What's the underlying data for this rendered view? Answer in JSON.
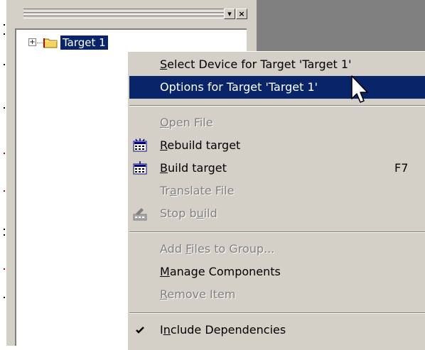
{
  "panel": {
    "title_buttons": {
      "dropdown_label": "▾",
      "close_label": "×"
    }
  },
  "tree": {
    "root": {
      "label": "Target 1",
      "expander": "+"
    }
  },
  "context_menu": {
    "items": [
      {
        "label": "Select Device for Target 'Target 1'",
        "accel": "S",
        "enabled": true
      },
      {
        "label": "Options for Target 'Target 1'",
        "enabled": true,
        "highlighted": true
      },
      {
        "label": "Open File",
        "accel": "O",
        "enabled": false
      },
      {
        "label": "Rebuild target",
        "accel": "R",
        "enabled": true,
        "icon": "rebuild-icon"
      },
      {
        "label": "Build target",
        "accel": "B",
        "enabled": true,
        "icon": "build-icon",
        "shortcut": "F7"
      },
      {
        "label": "Translate File",
        "accel": "a",
        "enabled": false
      },
      {
        "label": "Stop build",
        "accel": "u",
        "enabled": false,
        "icon": "stop-build-icon"
      },
      {
        "label": "Add Files to Group...",
        "accel": "F",
        "enabled": false
      },
      {
        "label": "Manage Components",
        "accel": "M",
        "enabled": true
      },
      {
        "label": "Remove Item",
        "accel": "R",
        "enabled": false
      },
      {
        "label": "Include Dependencies",
        "accel": "n",
        "enabled": true,
        "checked": true,
        "icon": "checkmark-icon"
      }
    ]
  },
  "colors": {
    "face": "#d4d0c8",
    "highlight": "#0a246a",
    "shadow": "#808080",
    "disabled_text": "#808080"
  }
}
